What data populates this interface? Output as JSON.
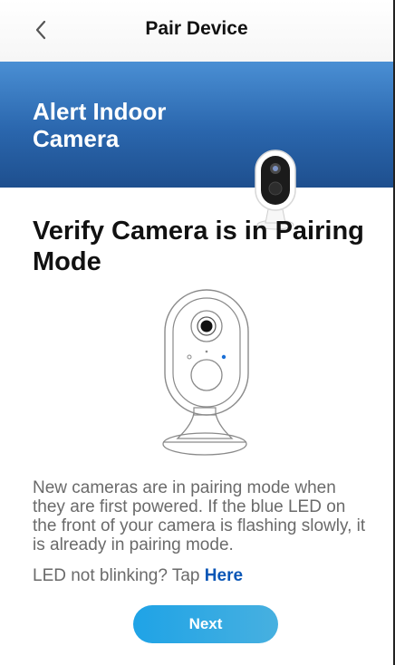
{
  "header": {
    "title": "Pair Device",
    "back_icon": "chevron-left-icon"
  },
  "banner": {
    "title": "Alert Indoor Camera",
    "image_icon": "security-camera-icon"
  },
  "main": {
    "title": "Verify Camera is in Pairing Mode",
    "illustration_icon": "camera-outline-icon",
    "description": "New cameras are in pairing mode when they are first powered. If the blue LED on the front of your camera is flashing slowly, it is already in pairing mode.",
    "hint_text": "LED not blinking? Tap ",
    "hint_link": "Here",
    "next_label": "Next"
  },
  "colors": {
    "accent_blue": "#1fa3e6",
    "banner_blue": "#2a66ad",
    "link_blue": "#0a56b6",
    "led_blue": "#1a6fd6"
  }
}
